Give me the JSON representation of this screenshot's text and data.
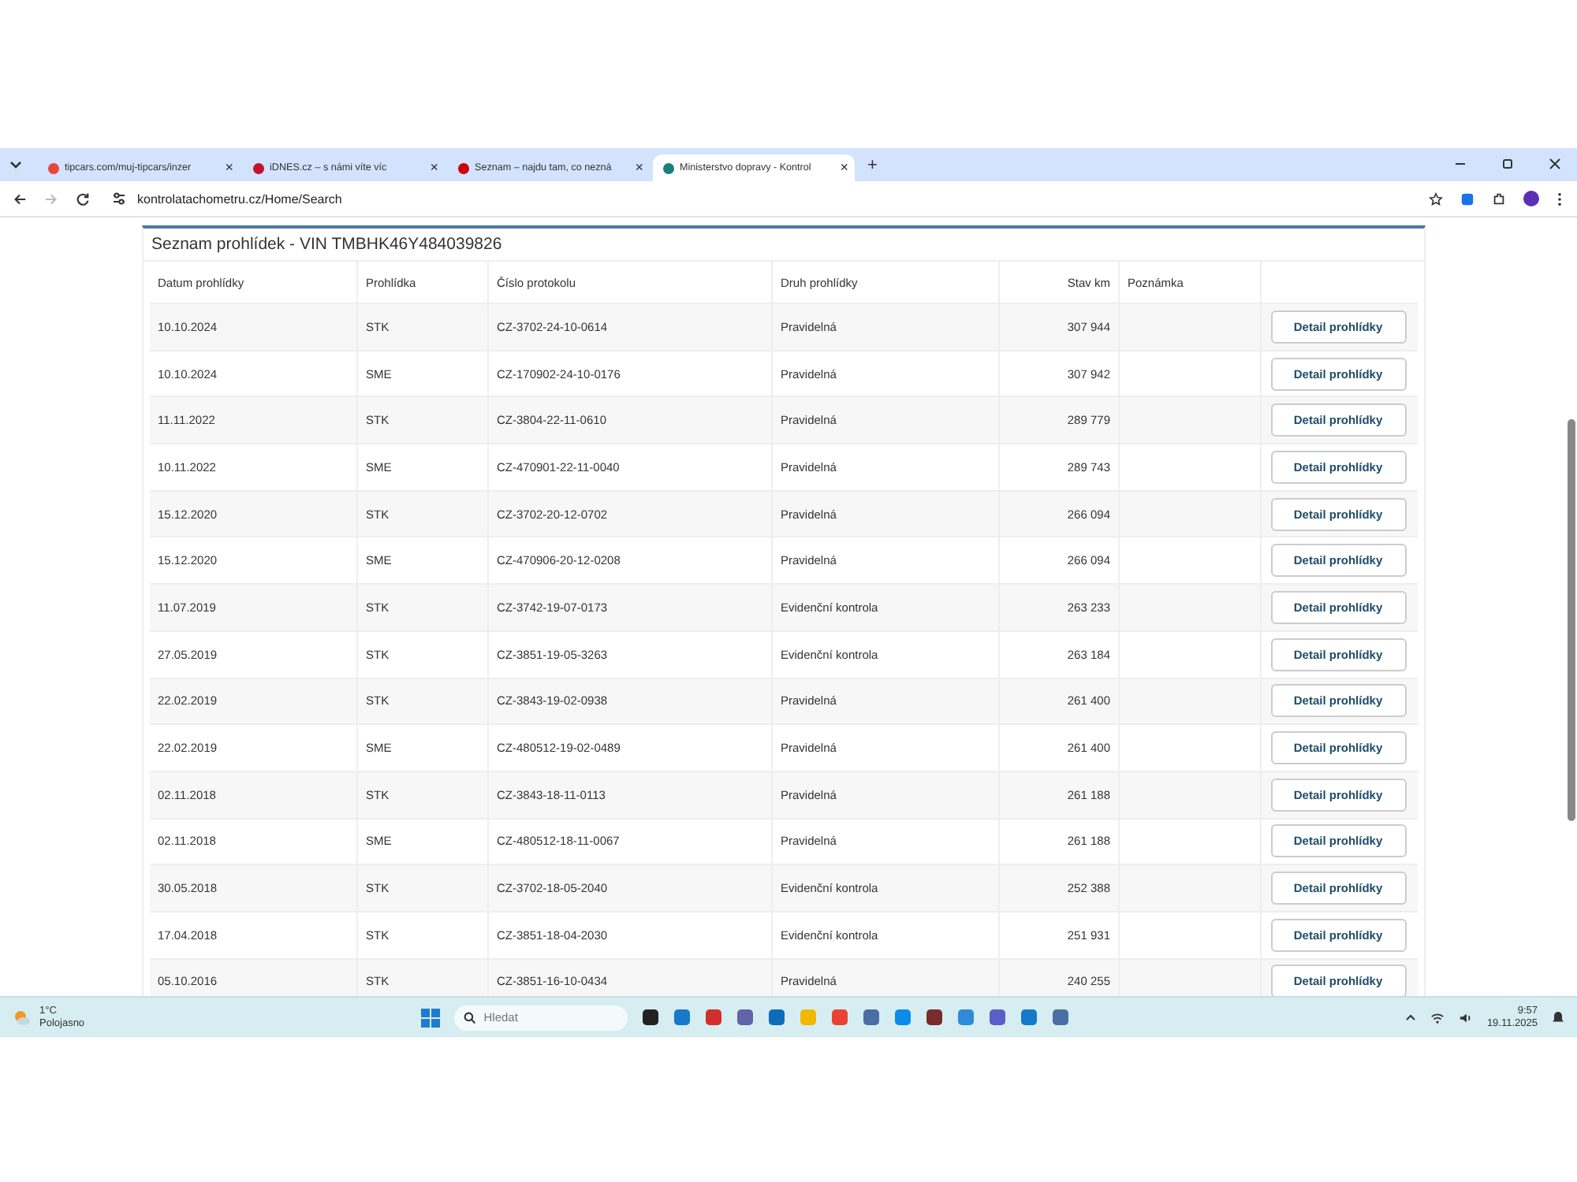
{
  "browser": {
    "tabs": [
      {
        "label": "tipcars.com/muj-tipcars/inzer",
        "close": "×",
        "selected": false
      },
      {
        "label": "iDNES.cz – s námi víte víc",
        "close": "×",
        "selected": false
      },
      {
        "label": "Seznam – najdu tam, co nezná",
        "close": "×",
        "selected": false
      },
      {
        "label": "Ministerstvo dopravy - Kontrol",
        "close": "×",
        "selected": true
      }
    ],
    "new_tab": "+",
    "address": "kontrolatachometru.cz/Home/Search"
  },
  "page": {
    "title": "Seznam prohlídek - VIN TMBHK46Y484039826",
    "columns": [
      "Datum prohlídky",
      "Prohlídka",
      "Číslo protokolu",
      "Druh prohlídky",
      "Stav km",
      "Poznámka"
    ],
    "rows": [
      {
        "date": "10.10.2024",
        "inspection": "STK",
        "protocol": "CZ-3702-24-10-0614",
        "type": "Pravidelná",
        "km": "307 944",
        "action": "Detail prohlídky"
      },
      {
        "date": "10.10.2024",
        "inspection": "SME",
        "protocol": "CZ-170902-24-10-0176",
        "type": "Pravidelná",
        "km": "307 942",
        "action": "Detail prohlídky"
      },
      {
        "date": "11.11.2022",
        "inspection": "STK",
        "protocol": "CZ-3804-22-11-0610",
        "type": "Pravidelná",
        "km": "289 779",
        "action": "Detail prohlídky"
      },
      {
        "date": "10.11.2022",
        "inspection": "SME",
        "protocol": "CZ-470901-22-11-0040",
        "type": "Pravidelná",
        "km": "289 743",
        "action": "Detail prohlídky"
      },
      {
        "date": "15.12.2020",
        "inspection": "STK",
        "protocol": "CZ-3702-20-12-0702",
        "type": "Pravidelná",
        "km": "266 094",
        "action": "Detail prohlídky"
      },
      {
        "date": "15.12.2020",
        "inspection": "SME",
        "protocol": "CZ-470906-20-12-0208",
        "type": "Pravidelná",
        "km": "266 094",
        "action": "Detail prohlídky"
      },
      {
        "date": "11.07.2019",
        "inspection": "STK",
        "protocol": "CZ-3742-19-07-0173",
        "type": "Evidenční kontrola",
        "km": "263 233",
        "action": "Detail prohlídky"
      },
      {
        "date": "27.05.2019",
        "inspection": "STK",
        "protocol": "CZ-3851-19-05-3263",
        "type": "Evidenční kontrola",
        "km": "263 184",
        "action": "Detail prohlídky"
      },
      {
        "date": "22.02.2019",
        "inspection": "STK",
        "protocol": "CZ-3843-19-02-0938",
        "type": "Pravidelná",
        "km": "261 400",
        "action": "Detail prohlídky"
      },
      {
        "date": "22.02.2019",
        "inspection": "SME",
        "protocol": "CZ-480512-19-02-0489",
        "type": "Pravidelná",
        "km": "261 400",
        "action": "Detail prohlídky"
      },
      {
        "date": "02.11.2018",
        "inspection": "STK",
        "protocol": "CZ-3843-18-11-0113",
        "type": "Pravidelná",
        "km": "261 188",
        "action": "Detail prohlídky"
      },
      {
        "date": "02.11.2018",
        "inspection": "SME",
        "protocol": "CZ-480512-18-11-0067",
        "type": "Pravidelná",
        "km": "261 188",
        "action": "Detail prohlídky"
      },
      {
        "date": "30.05.2018",
        "inspection": "STK",
        "protocol": "CZ-3702-18-05-2040",
        "type": "Evidenční kontrola",
        "km": "252 388",
        "action": "Detail prohlídky"
      },
      {
        "date": "17.04.2018",
        "inspection": "STK",
        "protocol": "CZ-3851-18-04-2030",
        "type": "Evidenční kontrola",
        "km": "251 931",
        "action": "Detail prohlídky"
      },
      {
        "date": "05.10.2016",
        "inspection": "STK",
        "protocol": "CZ-3851-16-10-0434",
        "type": "Pravidelná",
        "km": "240 255",
        "action": "Detail prohlídky"
      }
    ]
  },
  "taskbar": {
    "temperature": "1°C",
    "weather": "Polojasno",
    "search_placeholder": "Hledat",
    "time": "9:57",
    "date": "19.11.2025"
  }
}
